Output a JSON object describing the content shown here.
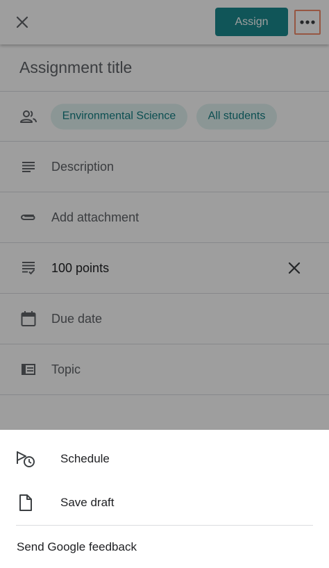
{
  "header": {
    "assign_label": "Assign"
  },
  "form": {
    "title_placeholder": "Assignment title",
    "class_chip": "Environmental Science",
    "students_chip": "All students",
    "description_placeholder": "Description",
    "attachment_label": "Add attachment",
    "points_value": "100 points",
    "due_date_label": "Due date",
    "topic_label": "Topic"
  },
  "sheet": {
    "items": [
      {
        "label": "Schedule",
        "icon": "schedule-icon"
      },
      {
        "label": "Save draft",
        "icon": "draft-icon"
      }
    ],
    "feedback_label": "Send Google feedback"
  },
  "colors": {
    "accent": "#1a8a8f",
    "chip_bg": "#e0f2f1",
    "chip_text": "#127f83",
    "highlight_border": "#f28b6b"
  }
}
